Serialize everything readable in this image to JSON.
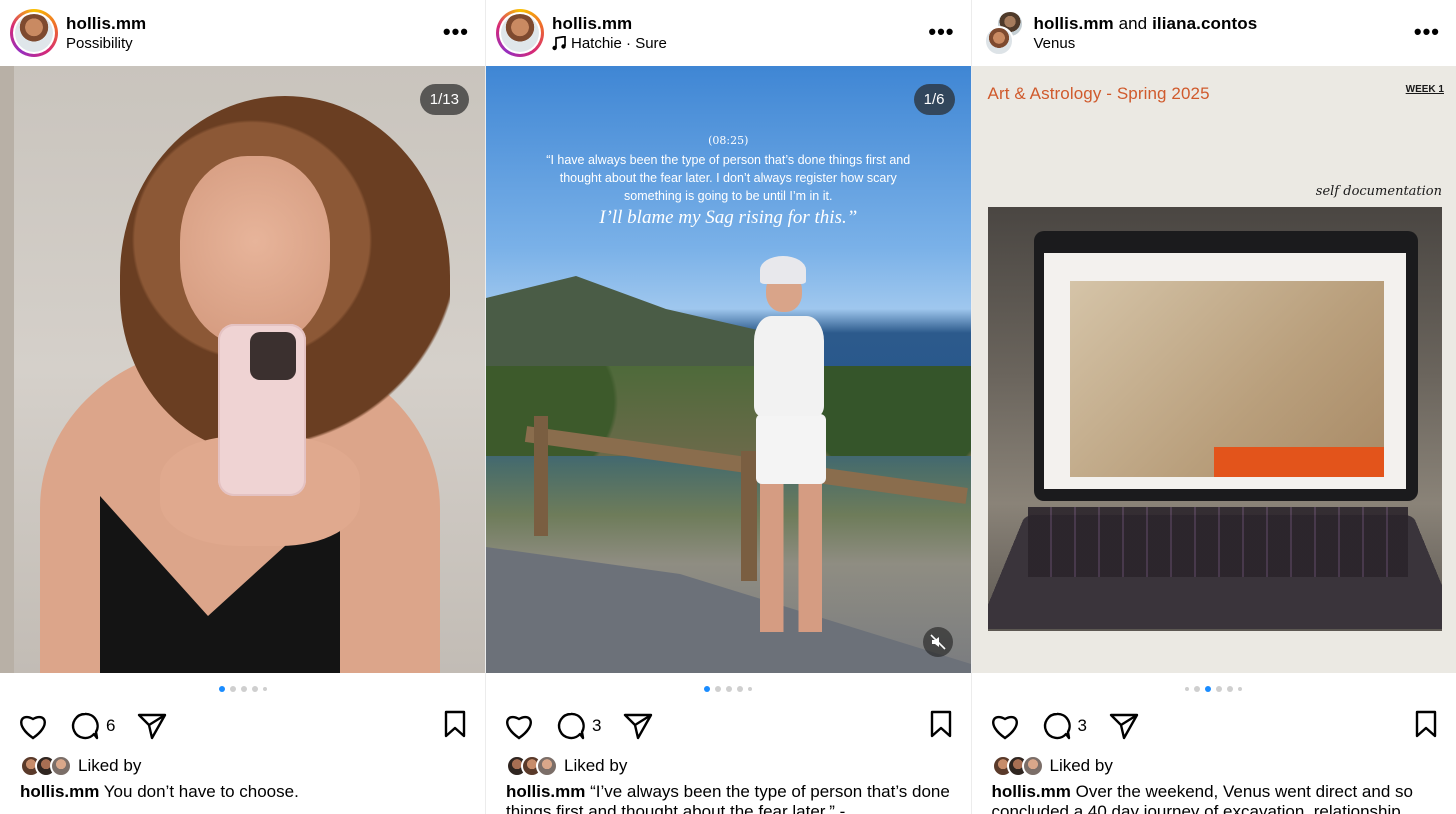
{
  "posts": [
    {
      "username": "hollis.mm",
      "subtitle": "Possibility",
      "more": "•••",
      "counter": "1/13",
      "comment_count": "6",
      "liked_by": "Liked by",
      "caption_user": "hollis.mm",
      "caption_text": "You don’t have to choose."
    },
    {
      "username": "hollis.mm",
      "subtitle": "Hatchie · Sure",
      "more": "•••",
      "counter": "1/6",
      "quote_time": "(08:25)",
      "quote_body": "“I have always been the type of person that’s done things first and thought about the fear later. I don’t always register how scary something is going to be until I’m in it.",
      "quote_italic": "I’ll blame my Sag rising for this.”",
      "comment_count": "3",
      "liked_by": "Liked by",
      "caption_user": "hollis.mm",
      "caption_text": "“I’ve always been the type of person that’s done things first and thought about the fear later.” -"
    },
    {
      "username": "hollis.mm",
      "and_text": "and",
      "collab_user": "iliana.contos",
      "subtitle": "Venus",
      "more": "•••",
      "art_title": "Art & Astrology - Spring 2025",
      "week_label": "WEEK 1",
      "script_label": "self documentation",
      "comment_count": "3",
      "liked_by": "Liked by",
      "caption_user": "hollis.mm",
      "caption_text": "Over the weekend, Venus went direct and so concluded a 40 day journey of excavation, relationship"
    }
  ],
  "colors": {
    "accent": "#1a8cff",
    "title_orange": "#d05a2c"
  }
}
